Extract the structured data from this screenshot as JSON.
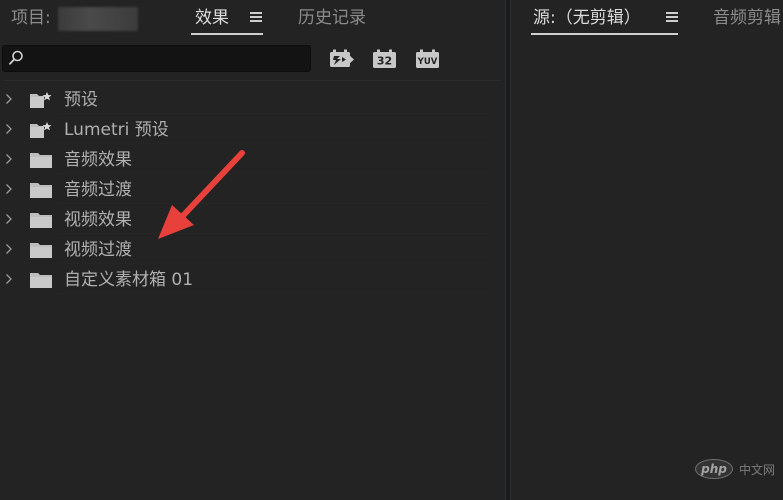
{
  "left_tabs": {
    "project_label": "项目:",
    "effects_label": "效果",
    "history_label": "历史记录"
  },
  "right_tabs": {
    "source_label": "源:（无剪辑）",
    "audio_mixer_label": "音频剪辑"
  },
  "search": {
    "placeholder": ""
  },
  "toolbar": {
    "accelerated_icon": "accelerated-effects-icon",
    "bit32_label": "32",
    "yuv_label": "YUV"
  },
  "effects_tree": {
    "items": [
      {
        "label": "预设",
        "icon": "star-folder-icon"
      },
      {
        "label": "Lumetri 预设",
        "icon": "star-folder-icon"
      },
      {
        "label": "音频效果",
        "icon": "folder-icon"
      },
      {
        "label": "音频过渡",
        "icon": "folder-icon"
      },
      {
        "label": "视频效果",
        "icon": "folder-icon"
      },
      {
        "label": "视频过渡",
        "icon": "folder-icon"
      },
      {
        "label": "自定义素材箱 01",
        "icon": "folder-icon"
      }
    ]
  },
  "annotation": {
    "arrow_color": "#e8403a",
    "target": "视频过渡"
  },
  "watermark": {
    "logo": "php",
    "text": "中文网"
  },
  "colors": {
    "panel_bg": "#232323",
    "text": "#b0b0b0",
    "active_text": "#dcdcdc"
  }
}
